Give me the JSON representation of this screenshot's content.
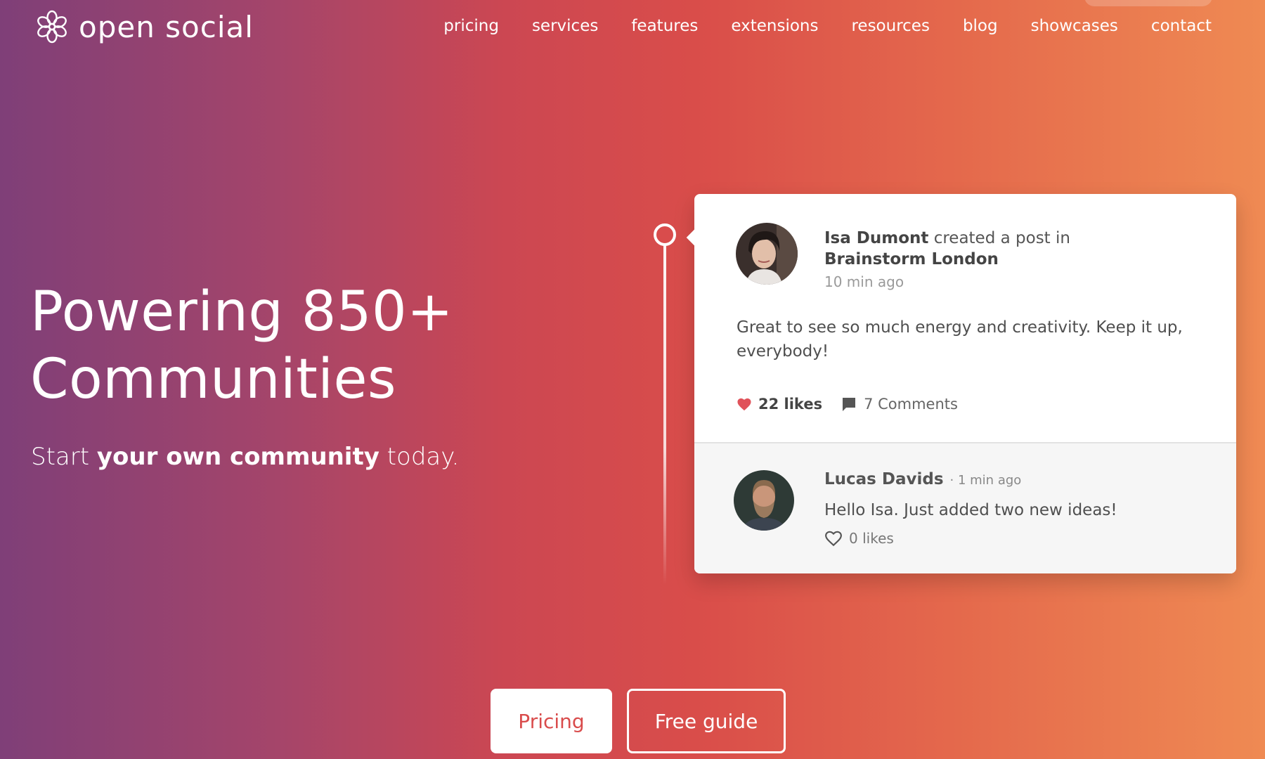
{
  "brand": {
    "name": "open social",
    "icon": "flower-logo-icon"
  },
  "nav": {
    "items": [
      "pricing",
      "services",
      "features",
      "extensions",
      "resources",
      "blog",
      "showcases",
      "contact"
    ]
  },
  "hero": {
    "title_line1": "Powering 850+",
    "title_line2": "Communities",
    "subtitle_pre": "Start ",
    "subtitle_bold": "your own community",
    "subtitle_post": " today."
  },
  "post": {
    "author": "Isa Dumont",
    "action": "created a post in",
    "group": "Brainstorm London",
    "time": "10 min ago",
    "body": "Great to see so much energy and creativity. Keep it up, everybody!",
    "likes": "22 likes",
    "comments": "7 Comments"
  },
  "reply": {
    "author": "Lucas Davids",
    "time": "· 1 min ago",
    "text": "Hello Isa. Just added two new ideas!",
    "likes": "0 likes"
  },
  "cta": {
    "primary": "Pricing",
    "secondary": "Free guide"
  },
  "colors": {
    "accent": "#d94c4c",
    "gradient_start": "#7f3f78",
    "gradient_end": "#ef8a53"
  }
}
